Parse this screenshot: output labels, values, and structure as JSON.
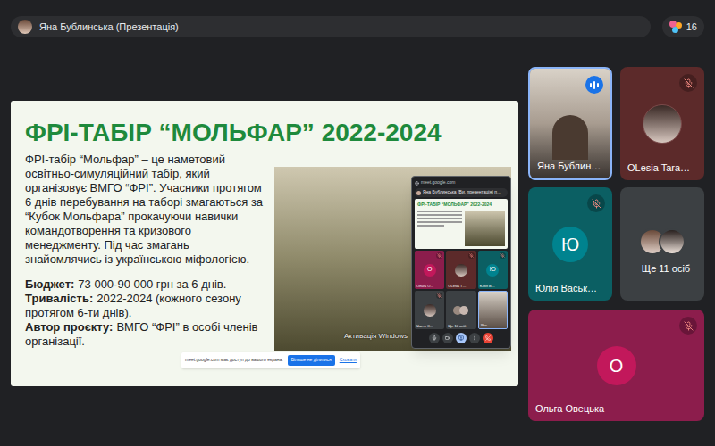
{
  "top_bar": {
    "presenter": "Яна Бублинська (Презентація)",
    "participant_count": "16"
  },
  "slide": {
    "title": "ФРІ-ТАБІР “МОЛЬФАР” 2022-2024",
    "description": "ФРІ-табір “Мольфар” – це наметовий освітньо-симуляційний табір, який організовує ВМГО “ФРІ”. Учасники протягом 6 днів перебування на таборі змагаються за “Кубок Мольфара” прокачуючи навички командотворення та кризового менеджменту. Під час змагань знайомлячись із українською міфологією.",
    "facts": [
      {
        "label": "Бюджет:",
        "value": "73 000-90 000 грн за 6 днів."
      },
      {
        "label": "Тривалість:",
        "value": "2022-2024 (кожного сезону протягом 6-ти днів)."
      },
      {
        "label": "Автор проєкту:",
        "value": "ВМГО “ФРІ” в особі членів організації."
      }
    ],
    "photo_watermark": "Активація Windows"
  },
  "share_notice": {
    "text": "meet.google.com має доступ до вашого екрана.",
    "buttons": [
      {
        "label": "Більше не ділитися",
        "primary": true
      },
      {
        "label": "Сховати",
        "primary": false
      }
    ]
  },
  "mini_window": {
    "url": "meet.google.com",
    "title": "Яна Бублинська (Ви, презентація) п…",
    "slide_title": "ФРІ-ТАБІР “МОЛЬФАР” 2022-2024",
    "tiles": [
      {
        "name": "Ольга О…",
        "kind": "letter",
        "letter": "О",
        "color": "#8c1d4c",
        "avatar_color": "#c2185b",
        "muted": true,
        "speaking": false
      },
      {
        "name": "OLesia T…",
        "kind": "photo",
        "color": "#5c2a2a",
        "muted": true,
        "speaking": false
      },
      {
        "name": "Юлія В…",
        "kind": "letter",
        "letter": "Ю",
        "color": "#0b5f63",
        "avatar_color": "#00838f",
        "muted": true,
        "speaking": false
      },
      {
        "name": "Частє С…",
        "kind": "photo",
        "color": "#3c4043",
        "muted": true,
        "speaking": false
      },
      {
        "name": "Ще 10 осіб",
        "kind": "others",
        "color": "#3c4043",
        "muted": false,
        "speaking": false
      },
      {
        "name": "Яна…",
        "kind": "video",
        "color": "#8a8078",
        "muted": false,
        "speaking": true
      }
    ],
    "controls": [
      {
        "kind": "mic",
        "highlighted": false
      },
      {
        "kind": "camera",
        "highlighted": false
      },
      {
        "kind": "present",
        "highlighted": true
      },
      {
        "kind": "more",
        "highlighted": false
      },
      {
        "kind": "end",
        "highlighted": false
      }
    ]
  },
  "tiles": [
    {
      "name": "Яна Бублин…",
      "kind": "video",
      "color": "#8a8078",
      "muted": false,
      "speaking": true
    },
    {
      "name": "OLesia Tara…",
      "kind": "photo",
      "color": "#5c2a2a",
      "muted": true,
      "speaking": false
    },
    {
      "name": "Юлія Васьк…",
      "kind": "letter",
      "letter": "Ю",
      "color": "#0b5f63",
      "avatar_color": "#00838f",
      "muted": true,
      "speaking": false
    },
    {
      "name": "Ще 11 осіб",
      "kind": "others",
      "color": "#3c4043",
      "muted": false,
      "speaking": false
    },
    {
      "name": "Ольга Овецька",
      "kind": "letter",
      "letter": "О",
      "color": "#8c1d4c",
      "avatar_color": "#c2185b",
      "muted": true,
      "speaking": false
    }
  ]
}
